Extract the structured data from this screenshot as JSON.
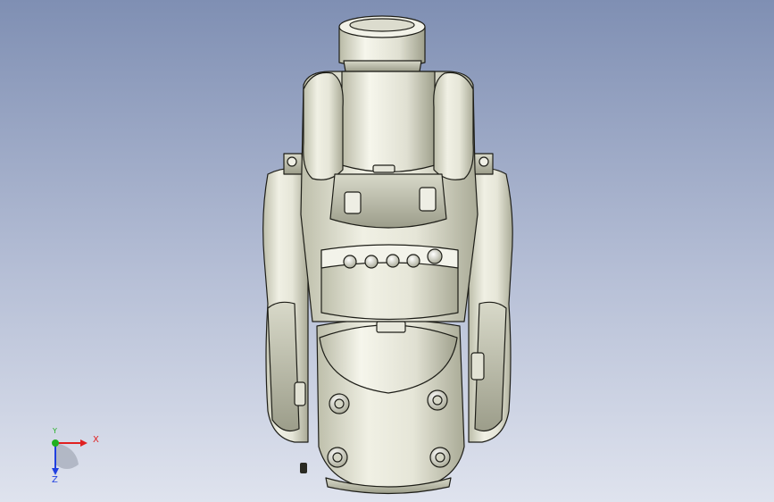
{
  "triad": {
    "x_label": "X",
    "y_label": "Y",
    "z_label": "Z",
    "colors": {
      "x": "#e02020",
      "y": "#20b020",
      "z": "#2040e0"
    }
  },
  "model": {
    "icon": "robot-arm-model",
    "shade_colors": {
      "light": "#f4f4ea",
      "mid": "#d9dacb",
      "dark": "#a7a895",
      "edge": "#1e1e18"
    }
  }
}
